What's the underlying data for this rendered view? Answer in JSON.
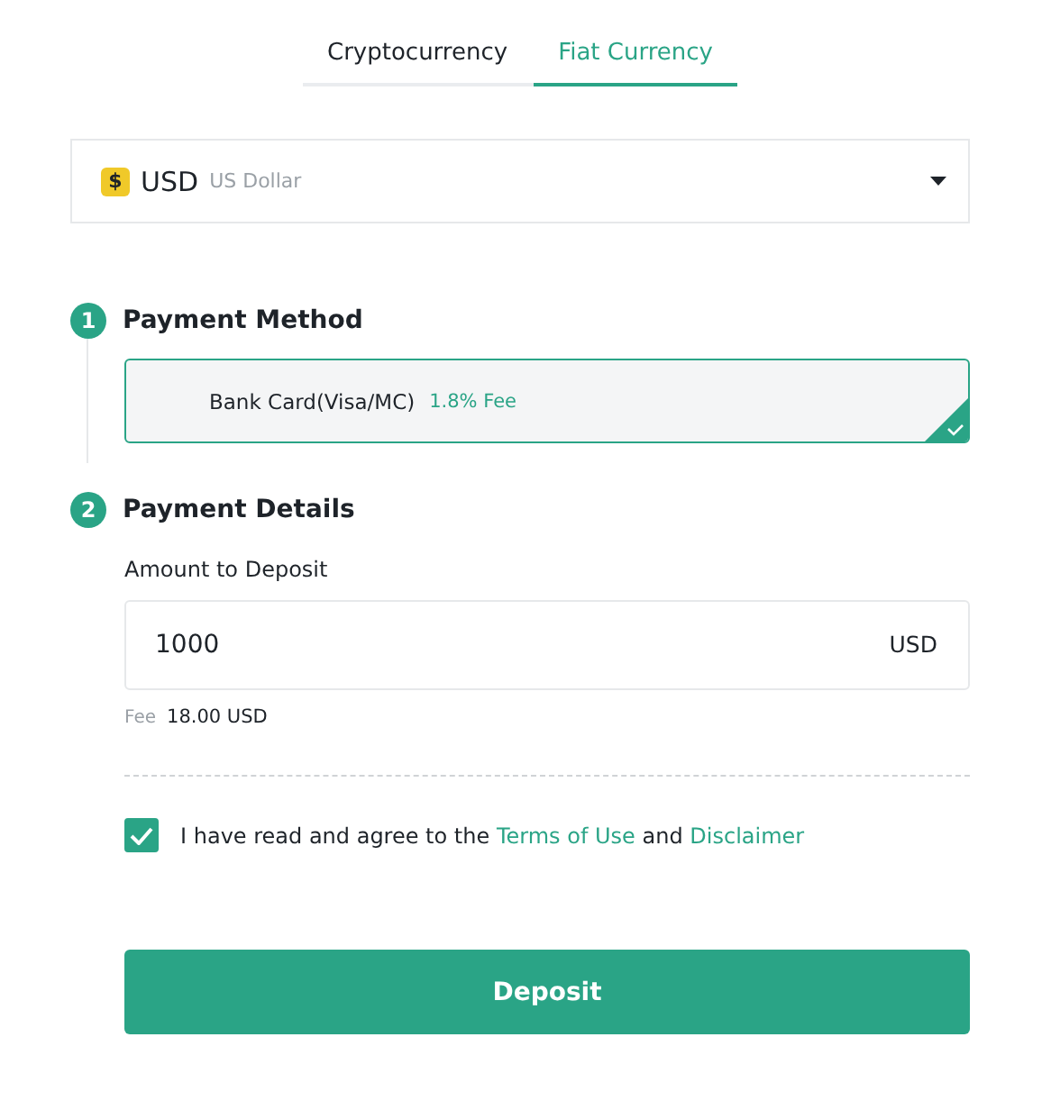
{
  "tabs": [
    {
      "label": "Cryptocurrency",
      "selected": false
    },
    {
      "label": "Fiat Currency",
      "selected": true
    }
  ],
  "currency_select": {
    "code": "USD",
    "name": "US Dollar",
    "symbol": "$"
  },
  "steps": [
    {
      "number": "1",
      "title": "Payment Method"
    },
    {
      "number": "2",
      "title": "Payment Details"
    }
  ],
  "payment_methods": [
    {
      "name": "Bank Card(Visa/MC)",
      "fee": "1.8% Fee",
      "selected": true
    }
  ],
  "amount": {
    "label": "Amount to Deposit",
    "value": "1000",
    "unit": "USD"
  },
  "fee": {
    "label": "Fee",
    "value": "18.00 USD"
  },
  "agreement": {
    "checked": true,
    "text": "I have read and agree to the",
    "terms_link": "Terms of Use",
    "joiner": "and",
    "disclaimer_link": "Disclaimer"
  },
  "submit_button": "Deposit"
}
